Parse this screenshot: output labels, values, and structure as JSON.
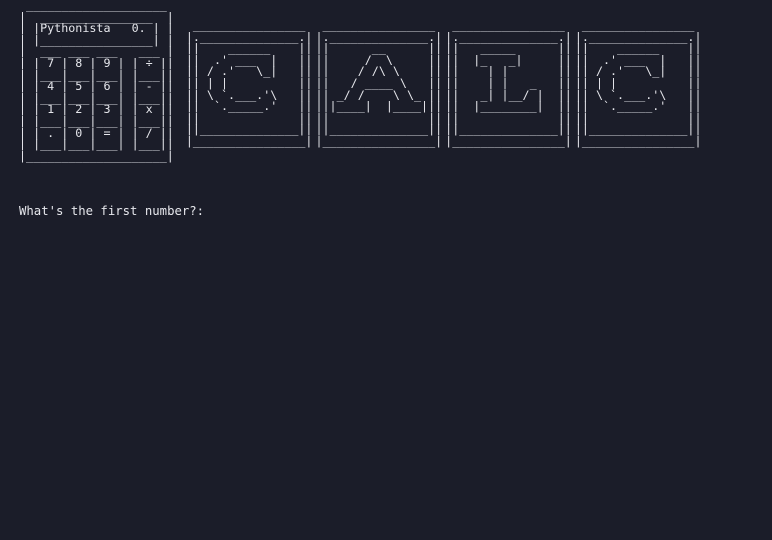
{
  "terminal": {
    "calculator_art": [
      " ____________________ ",
      "|  ________________  |",
      "| |Pythonista   0. | |",
      "| |________________| |",
      "|  ___ ___ ___   ___ |",
      "| | 7 | 8 | 9 | | ÷ ||",
      "| |___|___|___| |___||",
      "| | 4 | 5 | 6 | | - ||",
      "| |___|___|___| |___||",
      "| | 1 | 2 | 3 | | x ||",
      "| |___|___|___| |___||",
      "| | . | 0 | = | | / ||",
      "| |___|___|___| |___||",
      "|____________________|"
    ],
    "letter_c": [
      " ________________ ",
      "|.______________.|",
      "||    ______    ||",
      "||  .' ___  |   ||",
      "|| / .'   \\_|   ||",
      "|| | |          ||",
      "|| \\ `.___.'\\   ||",
      "||  `._____.'   ||",
      "||              ||",
      "||______________||",
      "|________________|"
    ],
    "letter_a": [
      " ________________ ",
      "|.______________.|",
      "||      __      ||",
      "||     /  \\     ||",
      "||    / /\\ \\    ||",
      "||   / ____ \\   ||",
      "|| _/ /    \\ \\_ ||",
      "|||____|  |____|||",
      "||              ||",
      "||______________||",
      "|________________|"
    ],
    "letter_l": [
      " ________________ ",
      "|.______________.|",
      "||   _____      ||",
      "||  |_   _|     ||",
      "||    | |       ||",
      "||    | |   _   ||",
      "||   _| |__/ |  ||",
      "||  |________|  ||",
      "||              ||",
      "||______________||",
      "|________________|"
    ],
    "letter_c2": [
      " ________________ ",
      "|.______________.|",
      "||    ______    ||",
      "||  .' ___  |   ||",
      "|| / .'   \\_|   ||",
      "|| | |          ||",
      "|| \\ `.___.'\\   ||",
      "||  `._____.'   ||",
      "||              ||",
      "||______________||",
      "|________________|"
    ],
    "prompt": "What's the first number?:"
  }
}
